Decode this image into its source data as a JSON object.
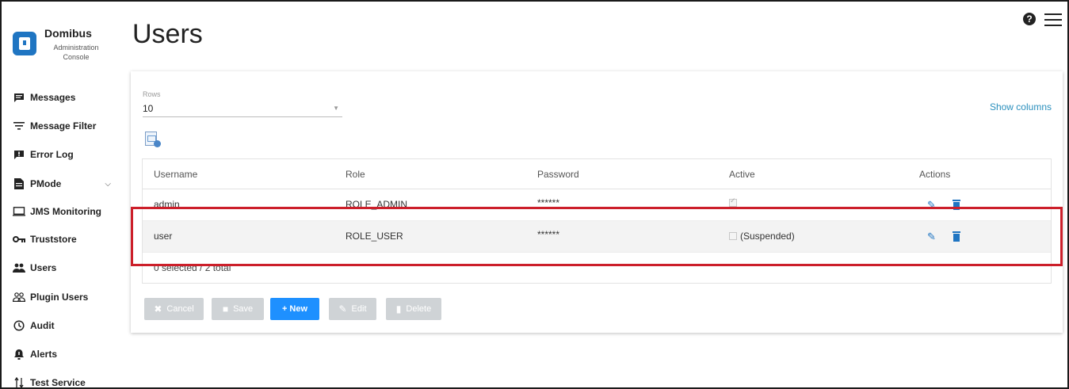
{
  "brand": {
    "name": "Domibus",
    "subtitle": "Administration Console"
  },
  "sidebar": {
    "items": [
      {
        "label": "Messages",
        "icon": "message-icon"
      },
      {
        "label": "Message Filter",
        "icon": "filter-icon"
      },
      {
        "label": "Error Log",
        "icon": "error-log-icon"
      },
      {
        "label": "PMode",
        "icon": "document-icon"
      },
      {
        "label": "JMS Monitoring",
        "icon": "monitor-icon"
      },
      {
        "label": "Truststore",
        "icon": "key-icon"
      },
      {
        "label": "Users",
        "icon": "users-icon"
      },
      {
        "label": "Plugin Users",
        "icon": "plugin-users-icon"
      },
      {
        "label": "Audit",
        "icon": "audit-icon"
      },
      {
        "label": "Alerts",
        "icon": "alert-icon"
      },
      {
        "label": "Test Service",
        "icon": "test-service-icon"
      }
    ]
  },
  "page": {
    "title": "Users"
  },
  "rows": {
    "label": "Rows",
    "value": "10"
  },
  "show_columns": "Show columns",
  "table": {
    "headers": [
      "Username",
      "Role",
      "Password",
      "Active",
      "Actions"
    ],
    "rows": [
      {
        "username": "admin",
        "role": "ROLE_ADMIN",
        "password": "******",
        "active": true,
        "active_text": ""
      },
      {
        "username": "user",
        "role": "ROLE_USER",
        "password": "******",
        "active": false,
        "active_text": "(Suspended)"
      }
    ],
    "footer": "0 selected / 2 total"
  },
  "buttons": {
    "cancel": "Cancel",
    "save": "Save",
    "new": "+ New",
    "edit": "Edit",
    "delete": "Delete"
  },
  "colors": {
    "accent": "#1e90ff",
    "brand": "#1f75c2",
    "link": "#2a8fbd",
    "highlight": "#cc1f2a",
    "disabled": "#cfd3d6"
  }
}
